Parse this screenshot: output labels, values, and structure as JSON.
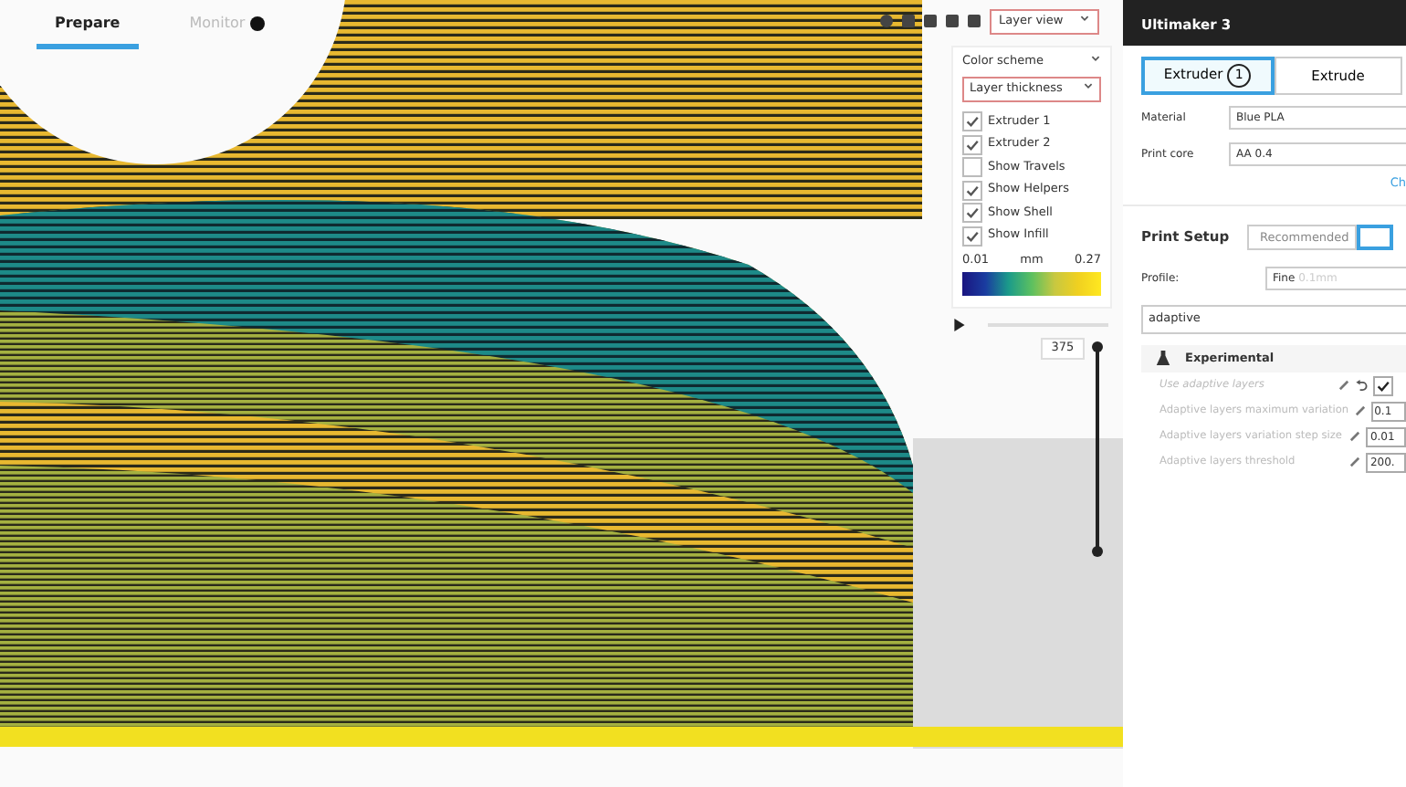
{
  "tabs": [
    {
      "label": "Prepare",
      "selected": true,
      "alert": false
    },
    {
      "label": "Monitor",
      "selected": false,
      "alert": true
    }
  ],
  "view_mode": "Layer view",
  "color_panel": {
    "title": "Color scheme",
    "scheme": "Layer thickness",
    "options": [
      {
        "label": "Extruder 1",
        "checked": true
      },
      {
        "label": "Extruder 2",
        "checked": true
      },
      {
        "label": "Show Travels",
        "checked": false
      },
      {
        "label": "Show Helpers",
        "checked": true
      },
      {
        "label": "Show Shell",
        "checked": true
      },
      {
        "label": "Show Infill",
        "checked": true
      }
    ],
    "legend": {
      "min": "0.01",
      "unit": "mm",
      "max": "0.27"
    }
  },
  "layer_slider": {
    "value": "375"
  },
  "sidebar": {
    "printer": "Ultimaker 3",
    "extruders": [
      {
        "label": "Extruder",
        "number": "1",
        "selected": true
      },
      {
        "label": "Extrude",
        "selected": false
      }
    ],
    "material": {
      "label": "Material",
      "value": "Blue PLA"
    },
    "print_core": {
      "label": "Print core",
      "value": "AA 0.4"
    },
    "link": "Ch",
    "print_setup": {
      "title": "Print Setup",
      "modes": [
        {
          "label": "Recommended",
          "selected": false
        },
        {
          "selected": true
        }
      ]
    },
    "profile": {
      "label": "Profile:",
      "value": "Fine",
      "detail": "0.1mm"
    },
    "search": {
      "value": "adaptive"
    },
    "category": {
      "title": "Experimental"
    },
    "settings": [
      {
        "label": "Use adaptive layers",
        "kind": "checkbox",
        "checked": true,
        "overridden": true
      },
      {
        "label": "Adaptive layers maximum variation",
        "kind": "value",
        "value": "0.1",
        "overridden": false
      },
      {
        "label": "Adaptive layers variation step size",
        "kind": "value",
        "value": "0.01",
        "overridden": false
      },
      {
        "label": "Adaptive layers threshold",
        "kind": "value",
        "value": "200.",
        "overridden": false
      }
    ]
  }
}
